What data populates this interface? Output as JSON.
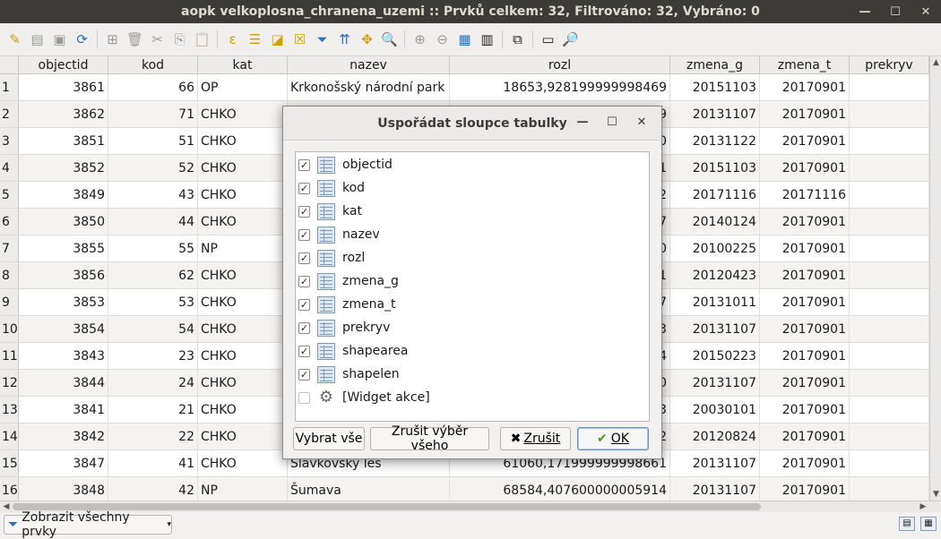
{
  "window": {
    "title": "aopk velkoplosna_chranena_uzemi :: Prvků celkem: 32, Filtrováno: 32, Vybráno: 0"
  },
  "table": {
    "columns": [
      "objectid",
      "kod",
      "kat",
      "nazev",
      "rozl",
      "zmena_g",
      "zmena_t",
      "prekryv"
    ],
    "rows": [
      {
        "n": "1",
        "objectid": "3861",
        "kod": "66",
        "kat": "OP",
        "nazev": "Krkonošský národní park",
        "rozl": "18653,928199999998469",
        "zmena_g": "20151103",
        "zmena_t": "20170901"
      },
      {
        "n": "2",
        "objectid": "3862",
        "kod": "71",
        "kat": "CHKO",
        "nazev": "",
        "rozl": "9",
        "zmena_g": "20131107",
        "zmena_t": "20170901"
      },
      {
        "n": "3",
        "objectid": "3851",
        "kod": "51",
        "kat": "CHKO",
        "nazev": "",
        "rozl": "0",
        "zmena_g": "20131122",
        "zmena_t": "20170901"
      },
      {
        "n": "4",
        "objectid": "3852",
        "kod": "52",
        "kat": "CHKO",
        "nazev": "",
        "rozl": "1",
        "zmena_g": "20151103",
        "zmena_t": "20170901"
      },
      {
        "n": "5",
        "objectid": "3849",
        "kod": "43",
        "kat": "CHKO",
        "nazev": "",
        "rozl": "2",
        "zmena_g": "20171116",
        "zmena_t": "20171116"
      },
      {
        "n": "6",
        "objectid": "3850",
        "kod": "44",
        "kat": "CHKO",
        "nazev": "",
        "rozl": "7",
        "zmena_g": "20140124",
        "zmena_t": "20170901"
      },
      {
        "n": "7",
        "objectid": "3855",
        "kod": "55",
        "kat": "NP",
        "nazev": "",
        "rozl": "0",
        "zmena_g": "20100225",
        "zmena_t": "20170901"
      },
      {
        "n": "8",
        "objectid": "3856",
        "kod": "62",
        "kat": "CHKO",
        "nazev": "",
        "rozl": "1",
        "zmena_g": "20120423",
        "zmena_t": "20170901"
      },
      {
        "n": "9",
        "objectid": "3853",
        "kod": "53",
        "kat": "CHKO",
        "nazev": "",
        "rozl": "7",
        "zmena_g": "20131011",
        "zmena_t": "20170901"
      },
      {
        "n": "10",
        "objectid": "3854",
        "kod": "54",
        "kat": "CHKO",
        "nazev": "",
        "rozl": "3",
        "zmena_g": "20131107",
        "zmena_t": "20170901"
      },
      {
        "n": "11",
        "objectid": "3843",
        "kod": "23",
        "kat": "CHKO",
        "nazev": "",
        "rozl": "4",
        "zmena_g": "20150223",
        "zmena_t": "20170901"
      },
      {
        "n": "12",
        "objectid": "3844",
        "kod": "24",
        "kat": "CHKO",
        "nazev": "",
        "rozl": "0",
        "zmena_g": "20131107",
        "zmena_t": "20170901"
      },
      {
        "n": "13",
        "objectid": "3841",
        "kod": "21",
        "kat": "CHKO",
        "nazev": "",
        "rozl": "3",
        "zmena_g": "20030101",
        "zmena_t": "20170901"
      },
      {
        "n": "14",
        "objectid": "3842",
        "kod": "22",
        "kat": "CHKO",
        "nazev": "",
        "rozl": "2",
        "zmena_g": "20120824",
        "zmena_t": "20170901"
      },
      {
        "n": "15",
        "objectid": "3847",
        "kod": "41",
        "kat": "CHKO",
        "nazev": "Slavkovský les",
        "rozl": "61060,171999999998661",
        "zmena_g": "20131107",
        "zmena_t": "20170901"
      },
      {
        "n": "16",
        "objectid": "3848",
        "kod": "42",
        "kat": "NP",
        "nazev": "Šumava",
        "rozl": "68584,407600000005914",
        "zmena_g": "20131107",
        "zmena_t": "20170901"
      }
    ]
  },
  "bottom": {
    "filter_label": "Zobrazit všechny prvky"
  },
  "dialog": {
    "title": "Uspořádat sloupce tabulky",
    "items": [
      {
        "label": "objectid",
        "checked": true,
        "icon": "column-icon"
      },
      {
        "label": "kod",
        "checked": true,
        "icon": "column-icon"
      },
      {
        "label": "kat",
        "checked": true,
        "icon": "column-icon"
      },
      {
        "label": "nazev",
        "checked": true,
        "icon": "column-icon"
      },
      {
        "label": "rozl",
        "checked": true,
        "icon": "column-icon"
      },
      {
        "label": "zmena_g",
        "checked": true,
        "icon": "column-icon"
      },
      {
        "label": "zmena_t",
        "checked": true,
        "icon": "column-icon"
      },
      {
        "label": "prekryv",
        "checked": true,
        "icon": "column-icon"
      },
      {
        "label": "shapearea",
        "checked": true,
        "icon": "column-icon"
      },
      {
        "label": "shapelen",
        "checked": true,
        "icon": "column-icon"
      },
      {
        "label": "[Widget akce]",
        "checked": false,
        "icon": "gear-icon"
      }
    ],
    "select_all": "Vybrat vše",
    "deselect_all": "Zrušit výběr všeho",
    "cancel": "Zrušit",
    "ok": "OK"
  }
}
